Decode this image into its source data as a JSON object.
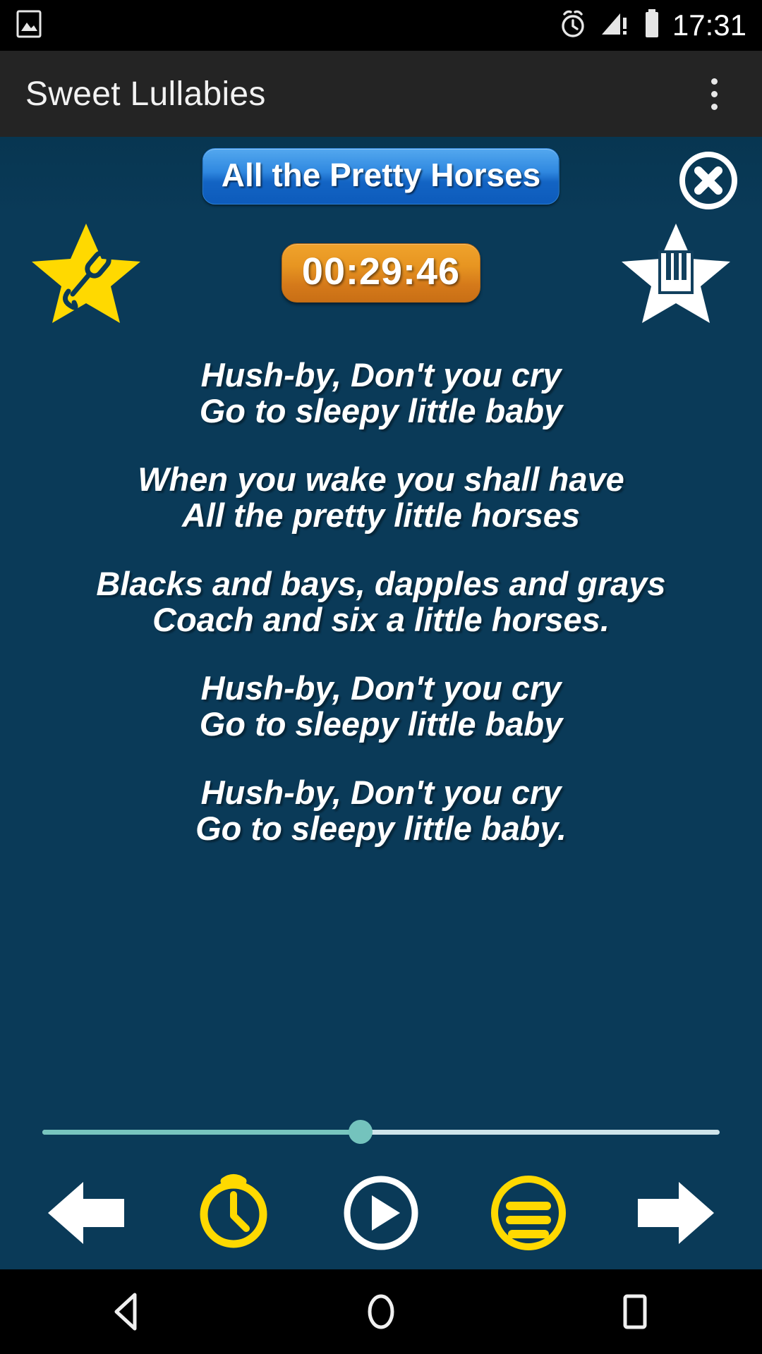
{
  "status_bar": {
    "time": "17:31",
    "icons": [
      "image-icon",
      "alarm-icon",
      "signal-warning-icon",
      "battery-icon"
    ]
  },
  "app_bar": {
    "title": "Sweet Lullabies",
    "overflow_label": "More options"
  },
  "player": {
    "song_title": "All the Pretty Horses",
    "timer": "00:29:46",
    "close_label": "Close",
    "left_star_label": "Vocal version",
    "right_star_label": "Piano version"
  },
  "lyrics": {
    "stanzas": [
      [
        "Hush-by, Don't you cry",
        "Go to sleepy little baby"
      ],
      [
        "When you wake you shall have",
        "All the pretty little horses"
      ],
      [
        "Blacks and bays, dapples and grays",
        "Coach and six a little horses."
      ],
      [
        "Hush-by, Don't you cry",
        "Go to sleepy little baby"
      ],
      [
        "Hush-by, Don't you cry",
        "Go to sleepy little baby."
      ]
    ]
  },
  "seek": {
    "progress_percent": 47,
    "filled_color": "#78c5bf",
    "track_color": "#cfe4ea"
  },
  "controls": [
    {
      "name": "previous-button",
      "icon": "arrow-left-icon",
      "label": "Previous"
    },
    {
      "name": "timer-button",
      "icon": "clock-icon",
      "label": "Sleep timer"
    },
    {
      "name": "play-button",
      "icon": "play-icon",
      "label": "Play"
    },
    {
      "name": "playlist-button",
      "icon": "list-icon",
      "label": "Playlist"
    },
    {
      "name": "next-button",
      "icon": "arrow-right-icon",
      "label": "Next"
    }
  ],
  "nav_bar": {
    "back_label": "Back",
    "home_label": "Home",
    "recents_label": "Recent apps"
  },
  "colors": {
    "background": "#0a3a58",
    "app_bar": "#242424",
    "accent_yellow": "#ffd900",
    "accent_orange": "#e79521",
    "accent_blue": "#2f88e0"
  }
}
